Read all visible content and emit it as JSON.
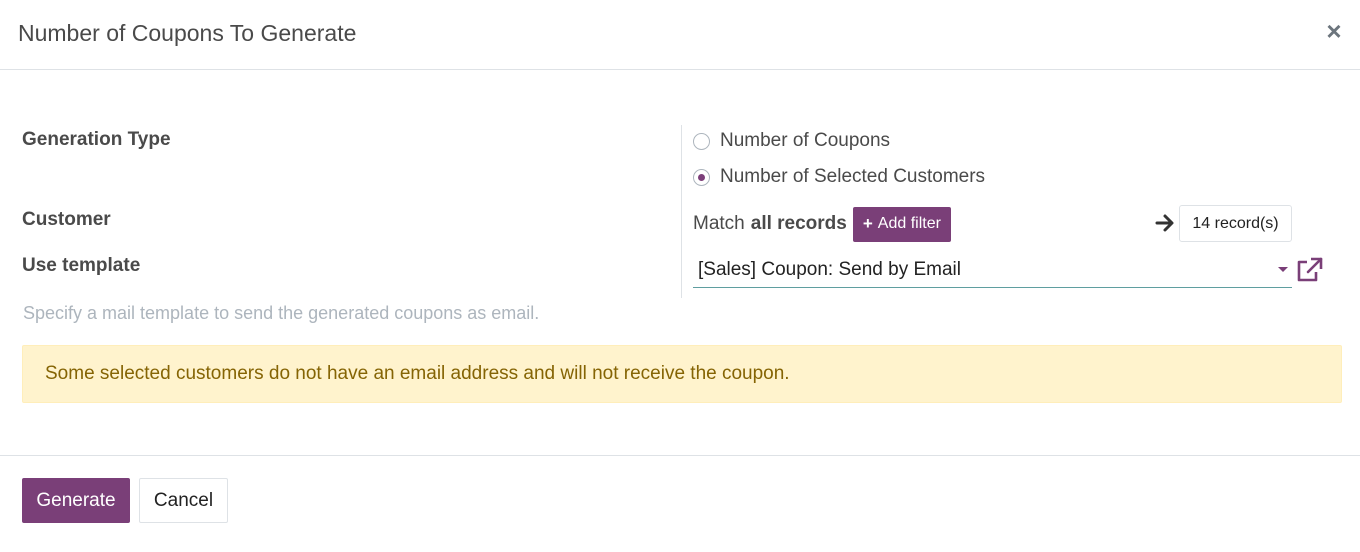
{
  "dialog": {
    "title": "Number of Coupons To Generate",
    "close_icon": "close-icon"
  },
  "form": {
    "generation_type": {
      "label": "Generation Type",
      "options": [
        {
          "label": "Number of Coupons",
          "checked": false
        },
        {
          "label": "Number of Selected Customers",
          "checked": true
        }
      ]
    },
    "customer": {
      "label": "Customer",
      "match_prefix": "Match",
      "match_bold": "all records",
      "add_filter_label": "Add filter",
      "records_label": "14 record(s)"
    },
    "use_template": {
      "label": "Use template",
      "value": "[Sales] Coupon: Send by Email",
      "help": "Specify a mail template to send the generated coupons as email."
    }
  },
  "alert": {
    "message": "Some selected customers do not have an email address and will not receive the coupon."
  },
  "footer": {
    "generate_label": "Generate",
    "cancel_label": "Cancel"
  },
  "colors": {
    "primary": "#7a3f78",
    "alert_bg": "#fff3cd",
    "alert_text": "#856404"
  }
}
